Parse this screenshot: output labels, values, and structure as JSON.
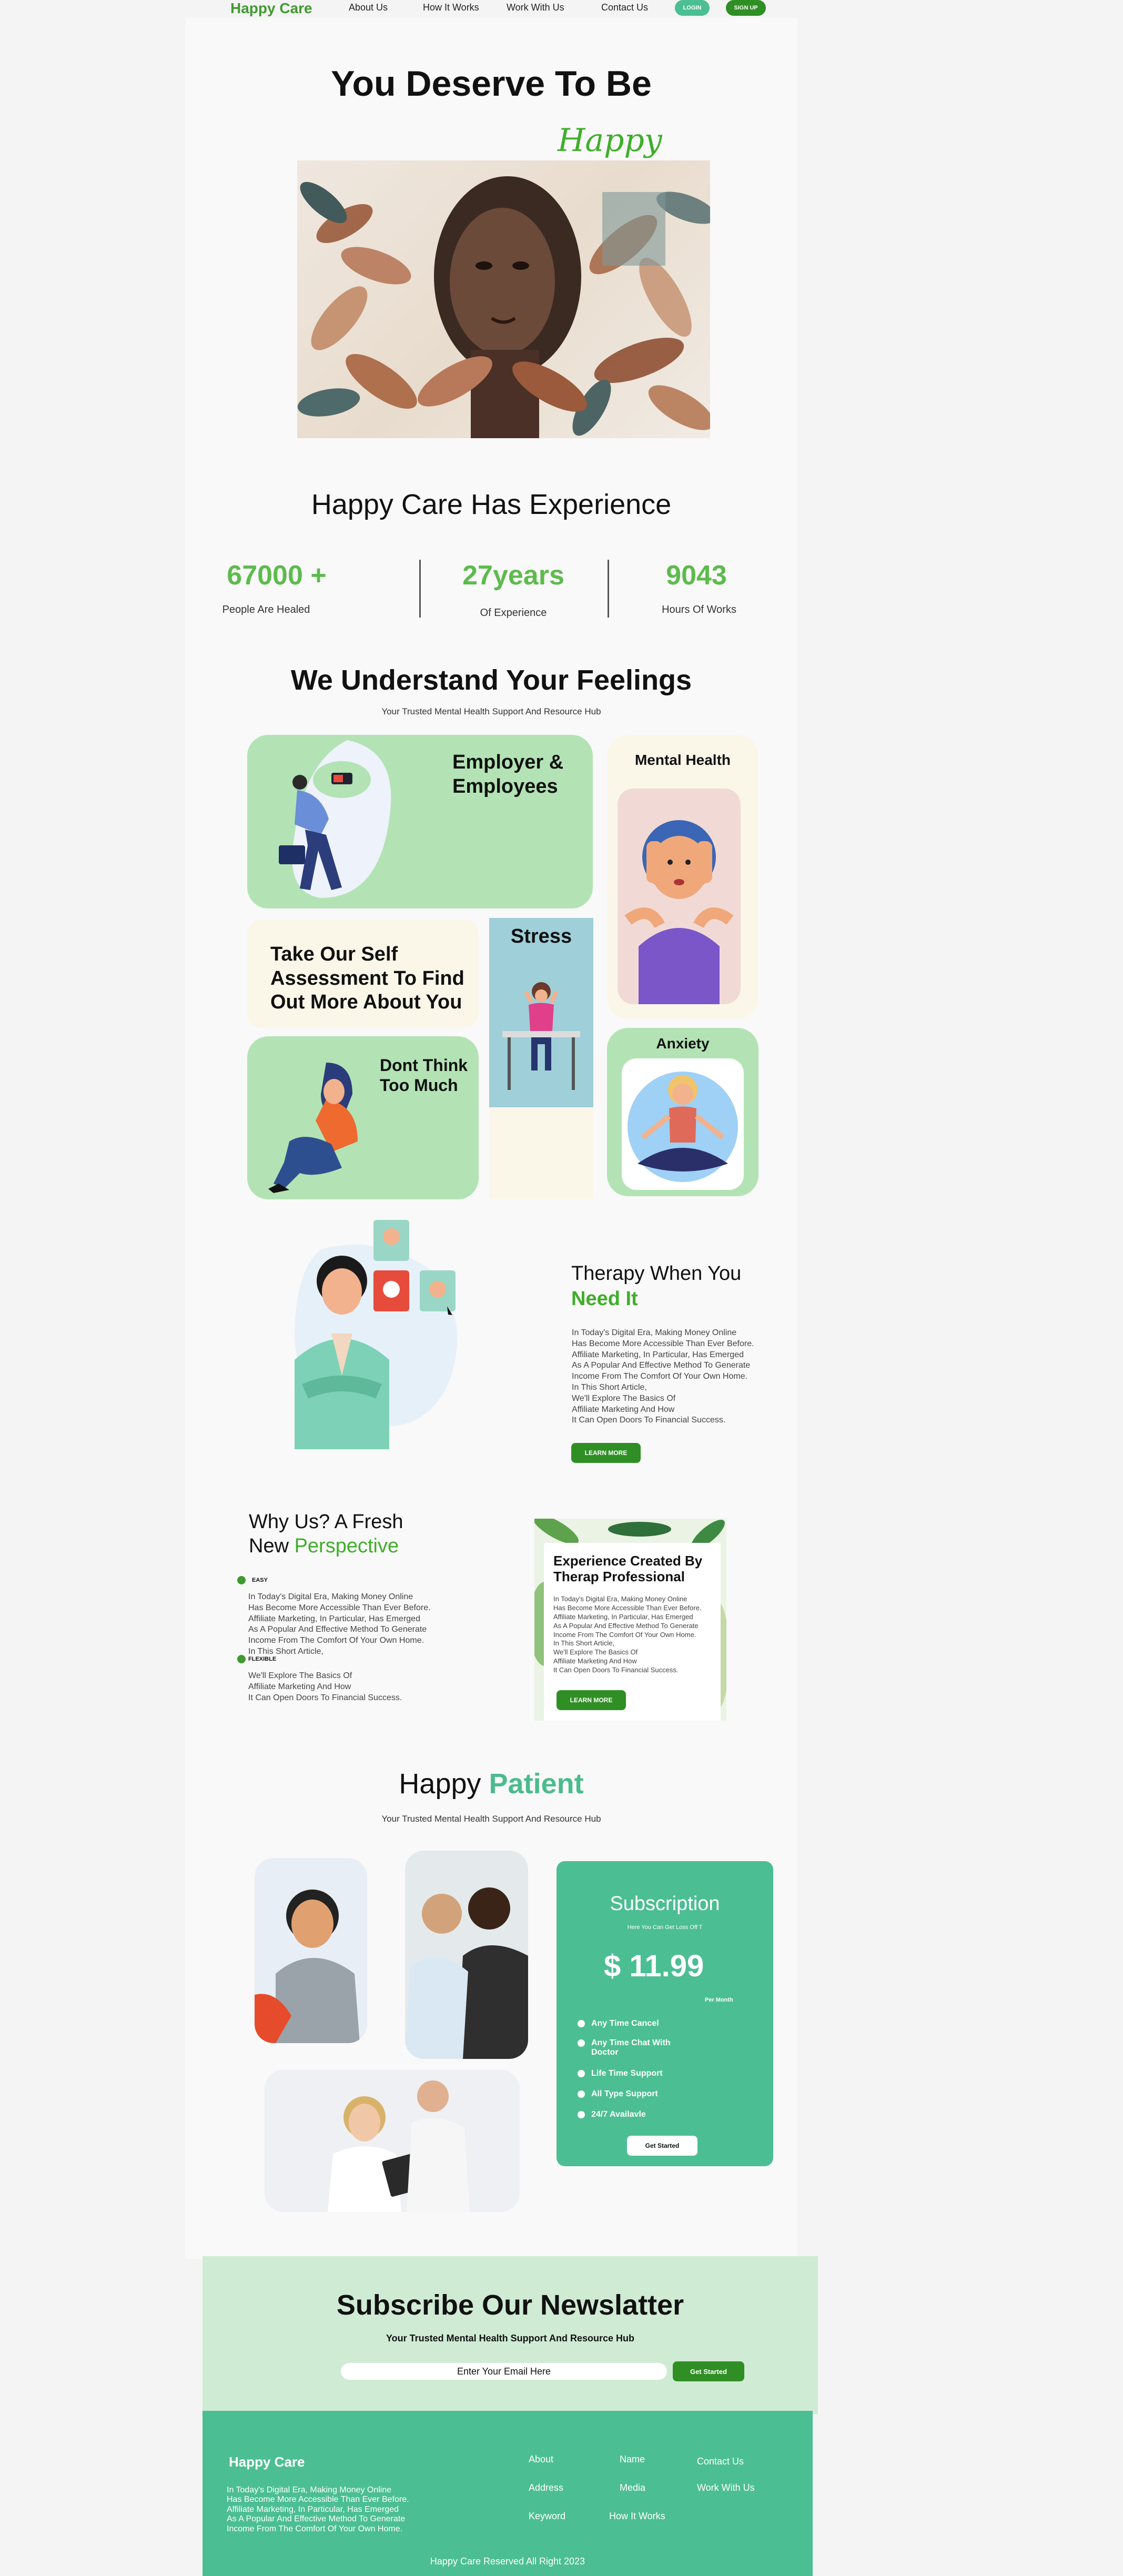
{
  "nav": {
    "brand": "Happy Care",
    "links": [
      "About Us",
      "How It Works",
      "Work With Us",
      "Contact Us"
    ],
    "login": "LOGIN",
    "signup": "SIGN UP"
  },
  "hero": {
    "title": "You Deserve To Be",
    "script": "Happy"
  },
  "experience": {
    "title": "Happy Care Has Experience",
    "stats": [
      {
        "value": "67000 +",
        "label": "People Are Healed"
      },
      {
        "value": "27years",
        "label": "Of Experience"
      },
      {
        "value": "9043",
        "label": "Hours Of Works"
      }
    ]
  },
  "feelings": {
    "title": "We Understand Your Feelings",
    "subtitle": "Your Trusted Mental Health Support And Resource Hub",
    "tiles": {
      "employer": "Employer & Employees",
      "mental": "Mental Health",
      "assessment": "Take Our Self Assessment To Find Out More About You",
      "stress": "Stress",
      "dont_think": "Dont Think Too Much",
      "anxiety": "Anxiety"
    }
  },
  "therapy": {
    "title_1": "Therapy When You",
    "title_2": "Need It",
    "body": "In Today's Digital Era, Making Money Online\nHas Become More Accessible Than Ever Before.\nAffiliate Marketing, In Particular, Has Emerged\nAs A Popular And Effective Method To Generate\nIncome From The Comfort Of Your Own Home.\nIn This Short Article,\nWe'll Explore The Basics Of\nAffiliate Marketing And How\nIt Can Open Doors To Financial Success.",
    "button": "LEARN MORE"
  },
  "why": {
    "title_1": "Why Us? A Fresh",
    "title_2a": "New ",
    "title_2b": "Perspective",
    "tag_easy": "EASY",
    "body_1": "In Today's Digital Era, Making Money Online\nHas Become More Accessible Than Ever Before.\nAffiliate Marketing, In Particular, Has Emerged\nAs A Popular And Effective Method To Generate\nIncome From The Comfort Of Your Own Home.\nIn This Short Article,",
    "tag_flexible": "FLEXIBLE",
    "body_2": "We'll Explore The Basics Of\nAffiliate Marketing And How\nIt Can Open Doors To Financial Success.",
    "card_title": "Experience Created By Therap Professional",
    "card_body": "In Today's Digital Era, Making Money Online\nHas Become More Accessible Than Ever Before.\nAffiliate Marketing, In Particular, Has Emerged\nAs A Popular And Effective Method To Generate\nIncome From The Comfort Of Your Own Home.\nIn This Short Article,\nWe'll Explore The Basics Of\nAffiliate Marketing And How\nIt Can Open Doors To Financial Success.",
    "card_button": "LEARN MORE"
  },
  "patient": {
    "title_a": "Happy ",
    "title_b": "Patient",
    "subtitle": "Your Trusted Mental Health Support And Resource Hub"
  },
  "subscription": {
    "title": "Subscription",
    "tagline": "Here You Can Get Loss Off T",
    "price": "$ 11.99",
    "period": "Per Month",
    "features": [
      "Any Time Cancel",
      "Any Time Chat With Doctor",
      "Life Time Support",
      "All Type Support",
      "24/7 Availavle"
    ],
    "button": "Get Started"
  },
  "newsletter": {
    "title": "Subscribe Our Newslatter",
    "subtitle": "Your Trusted Mental Health Support And Resource Hub",
    "placeholder": "Enter Your Email Here",
    "button": "Get Started"
  },
  "footer": {
    "brand": "Happy Care",
    "text": "In Today's Digital Era, Making Money Online\nHas Become More Accessible Than Ever Before.\nAffiliate Marketing, In Particular, Has Emerged\nAs A Popular And Effective Method To Generate\nIncome From The Comfort Of Your Own Home.",
    "col1": [
      "About",
      "Address",
      "Keyword"
    ],
    "col2": [
      "Name",
      "Media",
      "How It Works"
    ],
    "col3": [
      "Contact Us",
      "Work With Us"
    ],
    "copyright": "Happy Care Reserved All Right 2023"
  },
  "colors": {
    "brand_green": "#3f9a2e",
    "stat_green": "#5dbb4d",
    "teal": "#4cbe94",
    "tile_green": "#b3e3b4",
    "cream": "#faf7e9"
  }
}
